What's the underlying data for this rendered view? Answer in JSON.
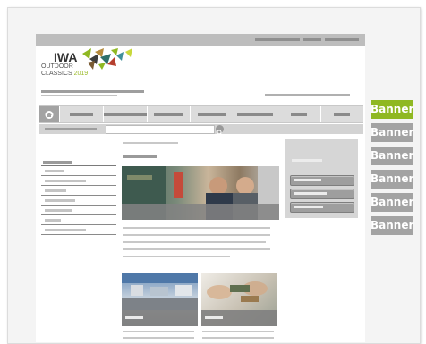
{
  "logo": {
    "brand": "IWA",
    "line1": "OUTDOOR",
    "line2": "CLASSICS",
    "year": "2019"
  },
  "nav": {
    "home_icon": "home-icon",
    "item_count": 7
  },
  "search": {
    "button_icon": "search-icon"
  },
  "banners": [
    {
      "label": "Banner",
      "color": "#8fb822"
    },
    {
      "label": "Banner",
      "color": "#a3a3a3"
    },
    {
      "label": "Banner",
      "color": "#a3a3a3"
    },
    {
      "label": "Banner",
      "color": "#a3a3a3"
    },
    {
      "label": "Banner",
      "color": "#a3a3a3"
    },
    {
      "label": "Banner",
      "color": "#a3a3a3"
    }
  ],
  "colors": {
    "accent": "#8fb822",
    "placeholder": "#a3a3a3"
  }
}
